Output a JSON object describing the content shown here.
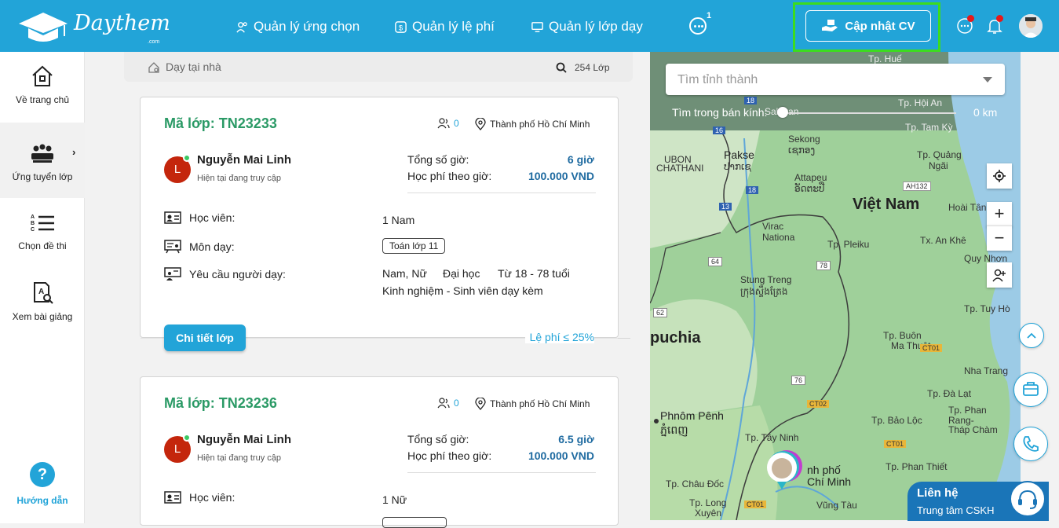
{
  "brand": {
    "name": "Daythem",
    "suffix": ".com"
  },
  "nav": {
    "items": [
      {
        "label": "Quản lý ứng chọn",
        "icon": "people-icon"
      },
      {
        "label": "Quản lý lệ phí",
        "icon": "fee-icon"
      },
      {
        "label": "Quản lý lớp dạy",
        "icon": "monitor-icon"
      }
    ],
    "more_badge": "1",
    "cv_button": "Cập nhật CV"
  },
  "sidebar": {
    "items": [
      {
        "label": "Về trang chủ",
        "icon": "home-icon"
      },
      {
        "label": "Ứng tuyển lớp",
        "icon": "classroom-icon",
        "active": true
      },
      {
        "label": "Chọn đề thi",
        "icon": "list-icon"
      },
      {
        "label": "Xem bài giảng",
        "icon": "document-search-icon"
      }
    ],
    "help": "Hướng dẫn"
  },
  "search": {
    "placeholder": "Dạy tại nhà",
    "count": "254 Lớp"
  },
  "cards": [
    {
      "code": "Mã lớp: TN23233",
      "applicants": "0",
      "location": "Thành phố Hồ Chí Minh",
      "tutor_initial": "L",
      "tutor_name": "Nguyễn Mai Linh",
      "tutor_status": "Hiện tại đang truy cập",
      "hours_label": "Tổng số giờ:",
      "hours_value": "6 giờ",
      "rate_label": "Học phí theo giờ:",
      "rate_value": "100.000 VND",
      "students_label": "Học viên:",
      "students_value": "1 Nam",
      "subject_label": "Môn dạy:",
      "subject_value": "Toán lớp 11",
      "req_label": "Yêu cầu người dạy:",
      "req_gender": "Nam, Nữ",
      "req_level": "Đại học",
      "req_age": "Từ 18 - 78 tuổi",
      "req_exp": "Kinh nghiệm - Sinh viên dạy kèm",
      "detail_button": "Chi tiết lớp",
      "fee": "Lệ phí ≤ 25%"
    },
    {
      "code": "Mã lớp: TN23236",
      "applicants": "0",
      "location": "Thành phố Hồ Chí Minh",
      "tutor_initial": "L",
      "tutor_name": "Nguyễn Mai Linh",
      "tutor_status": "Hiện tại đang truy cập",
      "hours_label": "Tổng số giờ:",
      "hours_value": "6.5 giờ",
      "rate_label": "Học phí theo giờ:",
      "rate_value": "100.000 VND",
      "students_label": "Học viên:",
      "students_value": "1 Nữ"
    }
  ],
  "map": {
    "province_placeholder": "Tìm tỉnh thành",
    "radius_label": "Tìm trong bán kính:",
    "radius_value": "0 km",
    "radius_level": 0,
    "zoom_in": "+",
    "zoom_out": "−",
    "labels": {
      "vietnam": "Việt Nam",
      "cambodia": "puchia",
      "pakse": "Pakse",
      "pakse_local": "ປາກເຊ",
      "sekong": "Sekong",
      "sekong_local": "ເຊກອງ",
      "attapeu": "Attapeu",
      "attapeu_local": "ອັດຕະປື",
      "ubon": "UBON",
      "ubon2": "CHATHANI",
      "virachey": "Virac",
      "virachey2": "Nationa",
      "stung_treng": "Stung Treng",
      "stung_treng_local": "ក្រុងស្ទឹងត្រែង",
      "pleiku": "Tp. Pleiku",
      "quang_ngai": "Tp. Quảng",
      "quang_ngai2": "Ngãi",
      "hoai_tan": "Hoài Tân",
      "an_khe": "Tx. An Khê",
      "quy_nhon": "Quy Nhơn",
      "tuy_hoa": "Tp. Tuy Hò",
      "buon_ma_thuot": "Tp. Buôn",
      "buon_ma_thuot2": "Ma Thuột",
      "nha_trang": "Nha Trang",
      "da_lat": "Tp. Đà Lạt",
      "bao_loc": "Tp. Bảo Lộc",
      "phan_rang": "Tp. Phan",
      "phan_rang2": "Rang-",
      "phan_rang3": "Tháp Chàm",
      "phan_thiet": "Tp. Phan Thiết",
      "phnom_penh": "Phnôm Pênh",
      "phnom_penh_local": "ភ្នំពេញ",
      "tay_ninh": "Tp. Tây Ninh",
      "hcm": "nh phố",
      "hcm2": "Chí Minh",
      "chau_doc": "Tp. Châu Đốc",
      "long_xuyen": "Tp. Long",
      "long_xuyen2": "Xuyên",
      "vung_tau": "Vũng Tàu",
      "hue": "Tp. Huế",
      "hoi_an": "Tp. Hội An",
      "tam_ky": "Tp. Tam Kỳ",
      "salavan": "Salavan",
      "ah132": "AH132",
      "ct01a": "CT01",
      "ct01b": "CT01",
      "ct01c": "CT01",
      "ct02": "CT02",
      "r18": "18",
      "r18b": "18",
      "r13": "13",
      "r64": "64",
      "r78": "78",
      "r62": "62",
      "r76": "76",
      "r16": "16"
    }
  },
  "support": {
    "title": "Liên hệ",
    "subtitle": "Trung tâm CSKH"
  },
  "colors": {
    "primary": "#22a4d8",
    "code_green": "#2b9a66",
    "highlight": "#3cdc1e",
    "cskh": "#1a75b8"
  }
}
